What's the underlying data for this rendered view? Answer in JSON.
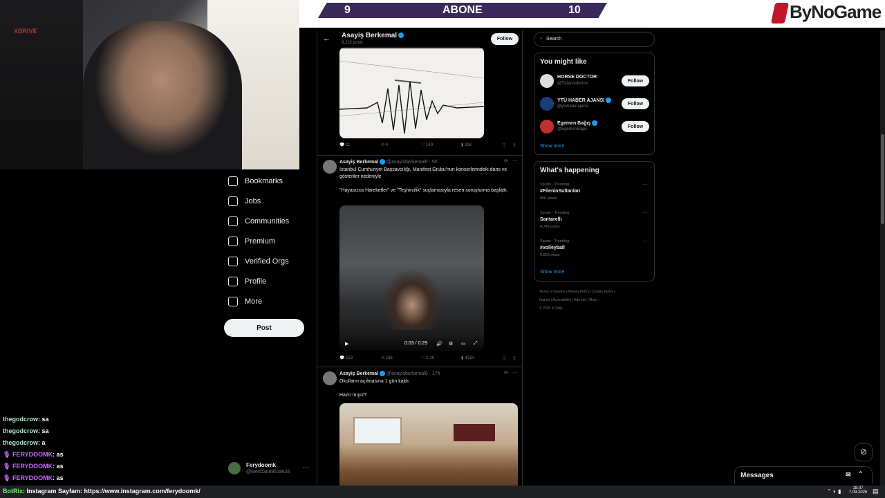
{
  "stream": {
    "abone_left": "9",
    "abone_label": "ABONE",
    "abone_right": "10",
    "brand": "ByNoGame"
  },
  "nav": {
    "items": [
      {
        "label": "Bookmarks",
        "icon": "bookmark-icon"
      },
      {
        "label": "Jobs",
        "icon": "briefcase-icon"
      },
      {
        "label": "Communities",
        "icon": "people-icon"
      },
      {
        "label": "Premium",
        "icon": "x-logo-icon"
      },
      {
        "label": "Verified Orgs",
        "icon": "lightning-icon"
      },
      {
        "label": "Profile",
        "icon": "person-icon"
      },
      {
        "label": "More",
        "icon": "more-circle-icon"
      }
    ],
    "post_label": "Post",
    "account_name": "Ferydoomk",
    "account_handle": "@Mertcan89618626",
    "account_more": "···"
  },
  "chat": [
    {
      "user": "thegodcrow",
      "msg": ": sa",
      "sub": false
    },
    {
      "user": "thegodcrow",
      "msg": ": sa",
      "sub": false
    },
    {
      "user": "thegodcrow",
      "msg": ": a",
      "sub": false
    },
    {
      "user": "FERYDOOMK",
      "msg": ": as",
      "sub": true
    },
    {
      "user": "FERYDOOMK",
      "msg": ": as",
      "sub": true
    },
    {
      "user": "FERYDOOMK",
      "msg": ": as",
      "sub": true
    }
  ],
  "bottom_bar": {
    "bot": "BotRix",
    "text": ": Instagram Sayfam: https://www.instagram.com/ferydoomk/",
    "time": "18:07",
    "date": "7.09.2025"
  },
  "profile_header": {
    "name": "Asayiş Berkemal",
    "posts": "9,232 posts",
    "follow": "Follow"
  },
  "tweets": [
    {
      "actions": [
        "11",
        "4",
        "140",
        "31K"
      ]
    },
    {
      "name": "Asayiş Berkemal",
      "handle": "@asayisberkemal0 · 5h",
      "text1": "İstanbul Cumhuriyet Başsavcılığı, Manifest Grubu'nun konserlerindeki dans ve gösteriler nedeniyle",
      "text2": "\"Hayasızca Hareketler\" ve \"Teşhircilik\" suçlamasıyla resen soruşturma başlattı.",
      "video_time": "0:03 / 0:29",
      "actions": [
        "533",
        "198",
        "2.2K",
        "401K"
      ]
    },
    {
      "name": "Asayiş Berkemal",
      "handle": "@asayisberkemal0 · 17h",
      "text1": "Okulların açılmasına 1 gün kaldı.",
      "text2": "Hazır mıyız?"
    }
  ],
  "search": {
    "placeholder": "Search"
  },
  "you_might_like": {
    "title": "You might like",
    "users": [
      {
        "name": "HORSE DOCTOR",
        "handle": "@Tizianooferroo",
        "verified": false,
        "color": "#dddddd"
      },
      {
        "name": "YTÜ HABER AJANSI",
        "handle": "@ytuhaberajansi",
        "verified": true,
        "color": "#1a3c7a"
      },
      {
        "name": "Egemen Bağış",
        "handle": "@EgemenBagis",
        "verified": true,
        "color": "#c03030"
      }
    ],
    "follow": "Follow",
    "show_more": "Show more"
  },
  "happening": {
    "title": "What's happening",
    "trends": [
      {
        "cat": "Sports · Trending",
        "title": "#FileninSultanları",
        "count": "85K posts"
      },
      {
        "cat": "Sports · Trending",
        "title": "Santarelli",
        "count": "4,748 posts"
      },
      {
        "cat": "Sports · Trending",
        "title": "#volleyball",
        "count": "6,803 posts"
      }
    ],
    "show_more": "Show more"
  },
  "footer": {
    "line1": "Terms of Service  |  Privacy Policy  |  Cookie Policy  |",
    "line2": "Imprint  |  Accessibility  |  Ads info  |  More ···",
    "line3": "© 2025 X Corp."
  },
  "messages": {
    "label": "Messages"
  }
}
